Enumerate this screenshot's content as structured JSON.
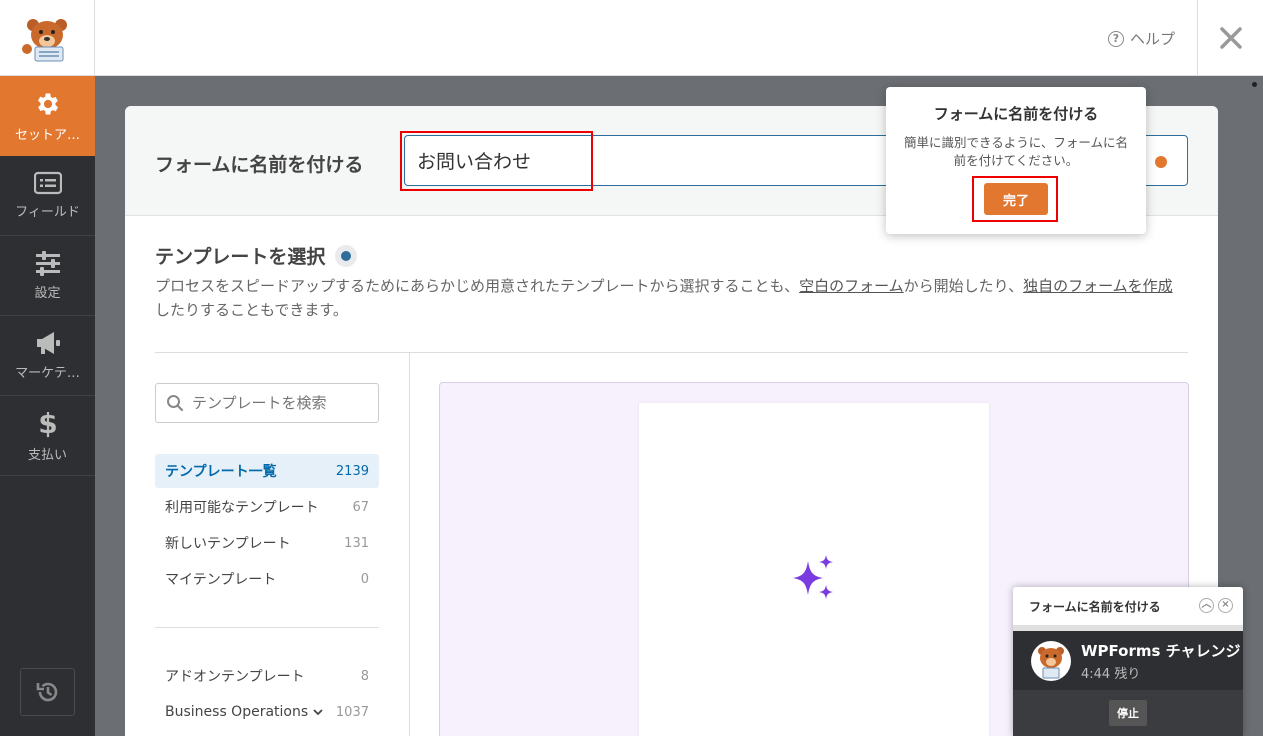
{
  "header": {
    "help_label": "ヘルプ",
    "help_icon": "question-circle-icon",
    "close_icon": "close-icon"
  },
  "sidebar": {
    "items": [
      {
        "label": "セットア…",
        "icon": "gear-icon",
        "active": true
      },
      {
        "label": "フィールド",
        "icon": "list-icon",
        "active": false
      },
      {
        "label": "設定",
        "icon": "sliders-icon",
        "active": false
      },
      {
        "label": "マーケテ…",
        "icon": "megaphone-icon",
        "active": false
      },
      {
        "label": "支払い",
        "icon": "dollar-icon",
        "active": false
      }
    ],
    "history_icon": "history-icon"
  },
  "form_name": {
    "label": "フォームに名前を付ける",
    "value": "お問い合わせ"
  },
  "templates": {
    "title": "テンプレートを選択",
    "desc_part1": "プロセスをスピードアップするためにあらかじめ用意されたテンプレートから選択することも、",
    "link_blank": "空白のフォーム",
    "desc_part2": "から開始したり、",
    "link_custom": "独自のフォームを作成",
    "desc_part3": "したりすることもできます。",
    "search_placeholder": "テンプレートを検索",
    "categories": [
      {
        "label": "テンプレート一覧",
        "count": "2139"
      },
      {
        "label": "利用可能なテンプレート",
        "count": "67"
      },
      {
        "label": "新しいテンプレート",
        "count": "131"
      },
      {
        "label": "マイテンプレート",
        "count": "0"
      }
    ],
    "categories2": [
      {
        "label": "アドオンテンプレート",
        "count": "8"
      },
      {
        "label": "Business Operations",
        "count": "1037"
      }
    ]
  },
  "tooltip": {
    "title": "フォームに名前を付ける",
    "text": "簡単に識別できるように、フォームに名前を付けてください。",
    "button": "完了"
  },
  "challenge": {
    "header": "フォームに名前を付ける",
    "name": "WPForms チャレンジ",
    "time": "4:44 残り",
    "stop": "停止"
  },
  "colors": {
    "accent": "#e27730",
    "sidebar_bg": "#2d2f32",
    "link_blue": "#036aab"
  }
}
